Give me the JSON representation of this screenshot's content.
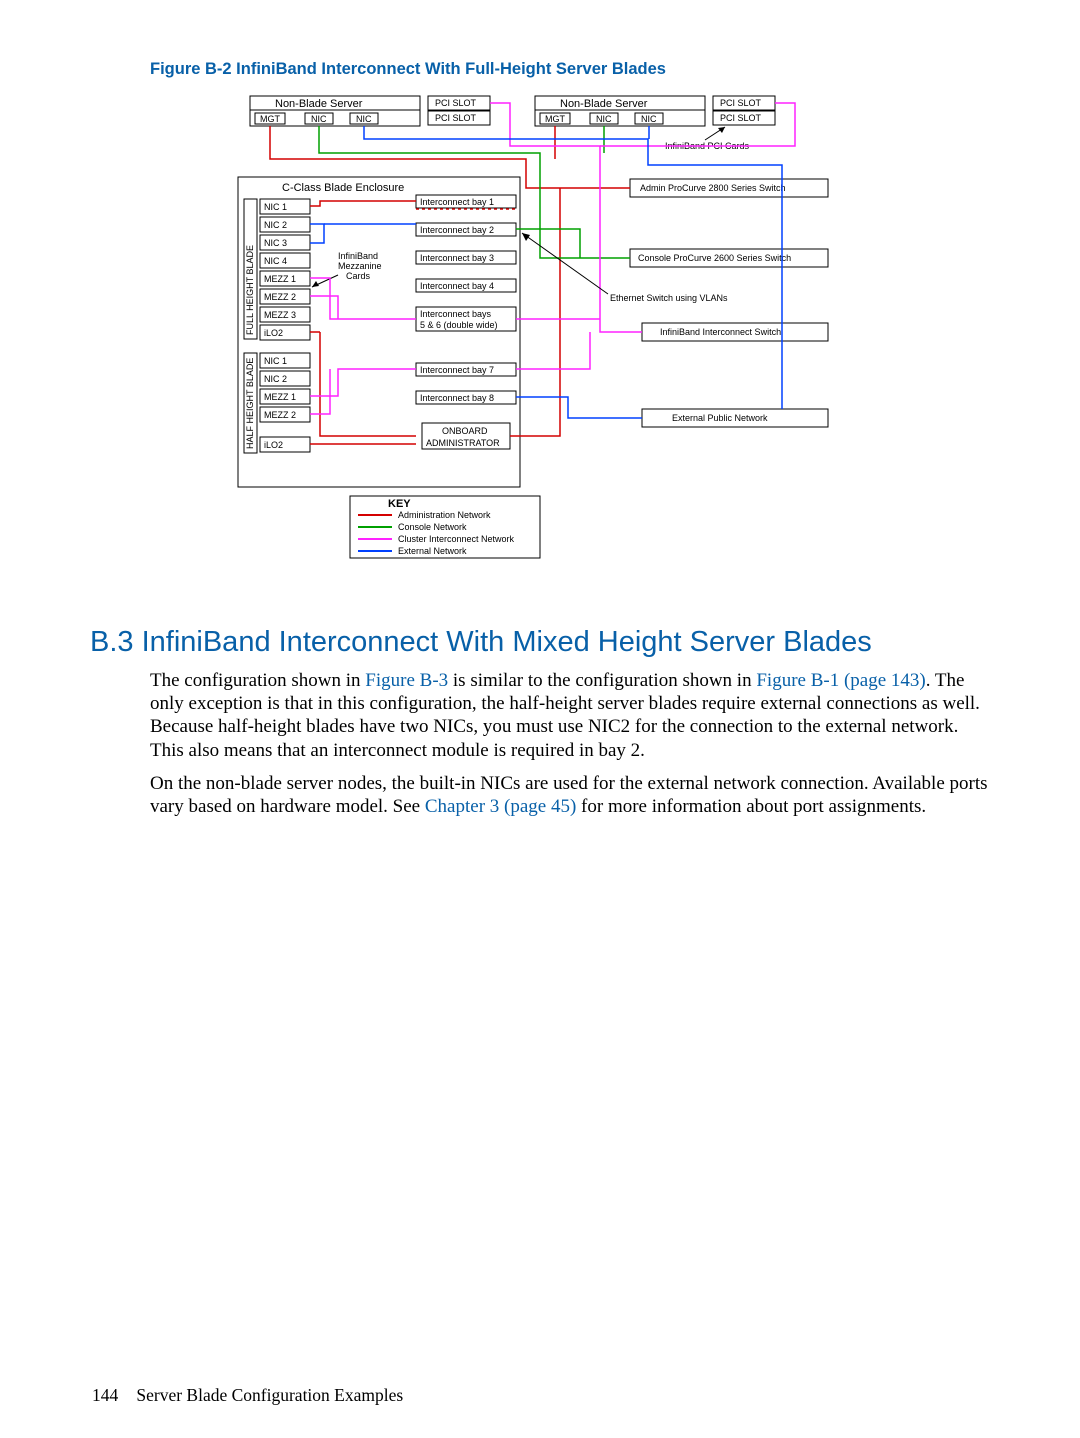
{
  "figure": {
    "caption": "Figure B-2 InfiniBand Interconnect With Full-Height Server Blades",
    "servers": [
      {
        "title": "Non-Blade Server",
        "ports": [
          "MGT",
          "NIC",
          "NIC"
        ],
        "pci": [
          "PCI SLOT",
          "PCI SLOT"
        ]
      },
      {
        "title": "Non-Blade Server",
        "ports": [
          "MGT",
          "NIC",
          "NIC"
        ],
        "pci": [
          "PCI SLOT",
          "PCI SLOT"
        ]
      }
    ],
    "pcicards_label": "InfiniBand PCI Cards",
    "enclosure": {
      "title": "C-Class Blade Enclosure",
      "full_label": "FULL HEIGHT BLADE",
      "half_label": "HALF HEIGHT BLADE",
      "full_items": [
        "NIC 1",
        "NIC 2",
        "NIC 3",
        "NIC 4",
        "MEZZ 1",
        "MEZZ 2",
        "MEZZ 3",
        "iLO2"
      ],
      "half_items": [
        "NIC 1",
        "NIC 2",
        "MEZZ 1",
        "MEZZ 2",
        "iLO2"
      ],
      "mezz_label_1": "InfiniBand",
      "mezz_label_2": "Mezzanine",
      "mezz_label_3": "Cards",
      "bays": [
        "Interconnect bay 1",
        "Interconnect bay 2",
        "Interconnect bay 3",
        "Interconnect bay 4",
        "Interconnect bays",
        "5 & 6 (double wide)",
        "Interconnect bay 7",
        "Interconnect bay 8"
      ],
      "onboard1": "ONBOARD",
      "onboard2": "ADMINISTRATOR"
    },
    "rightboxes": [
      "Admin ProCurve 2800 Series Switch",
      "Console ProCurve 2600 Series Switch",
      "Ethernet Switch using VLANs",
      "InfiniBand Interconnect Switch",
      "External Public Network"
    ],
    "key": {
      "title": "KEY",
      "items": [
        {
          "color": "#d40000",
          "label": "Administration Network"
        },
        {
          "color": "#00a000",
          "label": "Console Network"
        },
        {
          "color": "#ff22ff",
          "label": "Cluster Interconnect Network"
        },
        {
          "color": "#0040ff",
          "label": "External Network"
        }
      ]
    }
  },
  "section": {
    "title": "B.3 InfiniBand Interconnect With Mixed Height Server Blades",
    "p1a": "The configuration shown in ",
    "p1link1": "Figure B-3",
    "p1b": " is similar to the configuration shown in ",
    "p1link2": "Figure B-1 (page 143)",
    "p1c": ". The only exception is that in this configuration, the half-height server blades require external connections as well. Because half-height blades have two NICs, you must use NIC2 for the connection to the external network. This also means that an interconnect module is required in bay 2.",
    "p2a": "On the non-blade server nodes, the built-in NICs are used for the external network connection. Available ports vary based on hardware model. See ",
    "p2link": "Chapter 3 (page 45)",
    "p2b": " for more information about port assignments."
  },
  "footer": {
    "pagenum": "144",
    "text": "Server Blade Configuration Examples"
  }
}
